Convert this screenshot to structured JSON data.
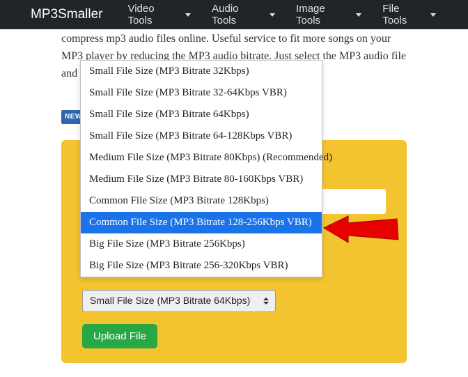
{
  "nav": {
    "brand": "MP3Smaller",
    "items": [
      "Video Tools",
      "Audio Tools",
      "Image Tools",
      "File Tools"
    ]
  },
  "description": "compress mp3 audio files online. Useful service to fit more songs on your MP3 player by reducing the MP3 audio bitrate. Just select the MP3 audio file and",
  "badge": "NEW",
  "dropdown": {
    "options": [
      "Small File Size (MP3 Bitrate 32Kbps)",
      "Small File Size (MP3 Bitrate 32-64Kbps VBR)",
      "Small File Size (MP3 Bitrate 64Kbps)",
      "Small File Size (MP3 Bitrate 64-128Kbps VBR)",
      "Medium File Size (MP3 Bitrate 80Kbps) (Recommended)",
      "Medium File Size (MP3 Bitrate 80-160Kbps VBR)",
      "Common File Size (MP3 Bitrate 128Kbps)",
      "Common File Size (MP3 Bitrate 128-256Kbps VBR)",
      "Big File Size (MP3 Bitrate 256Kbps)",
      "Big File Size (MP3 Bitrate 256-320Kbps VBR)"
    ],
    "highlighted_index": 7
  },
  "select": {
    "current": "Small File Size (MP3 Bitrate 64Kbps)"
  },
  "upload_label": "Upload File",
  "annotation": {
    "arrow_color": "#e60000"
  }
}
